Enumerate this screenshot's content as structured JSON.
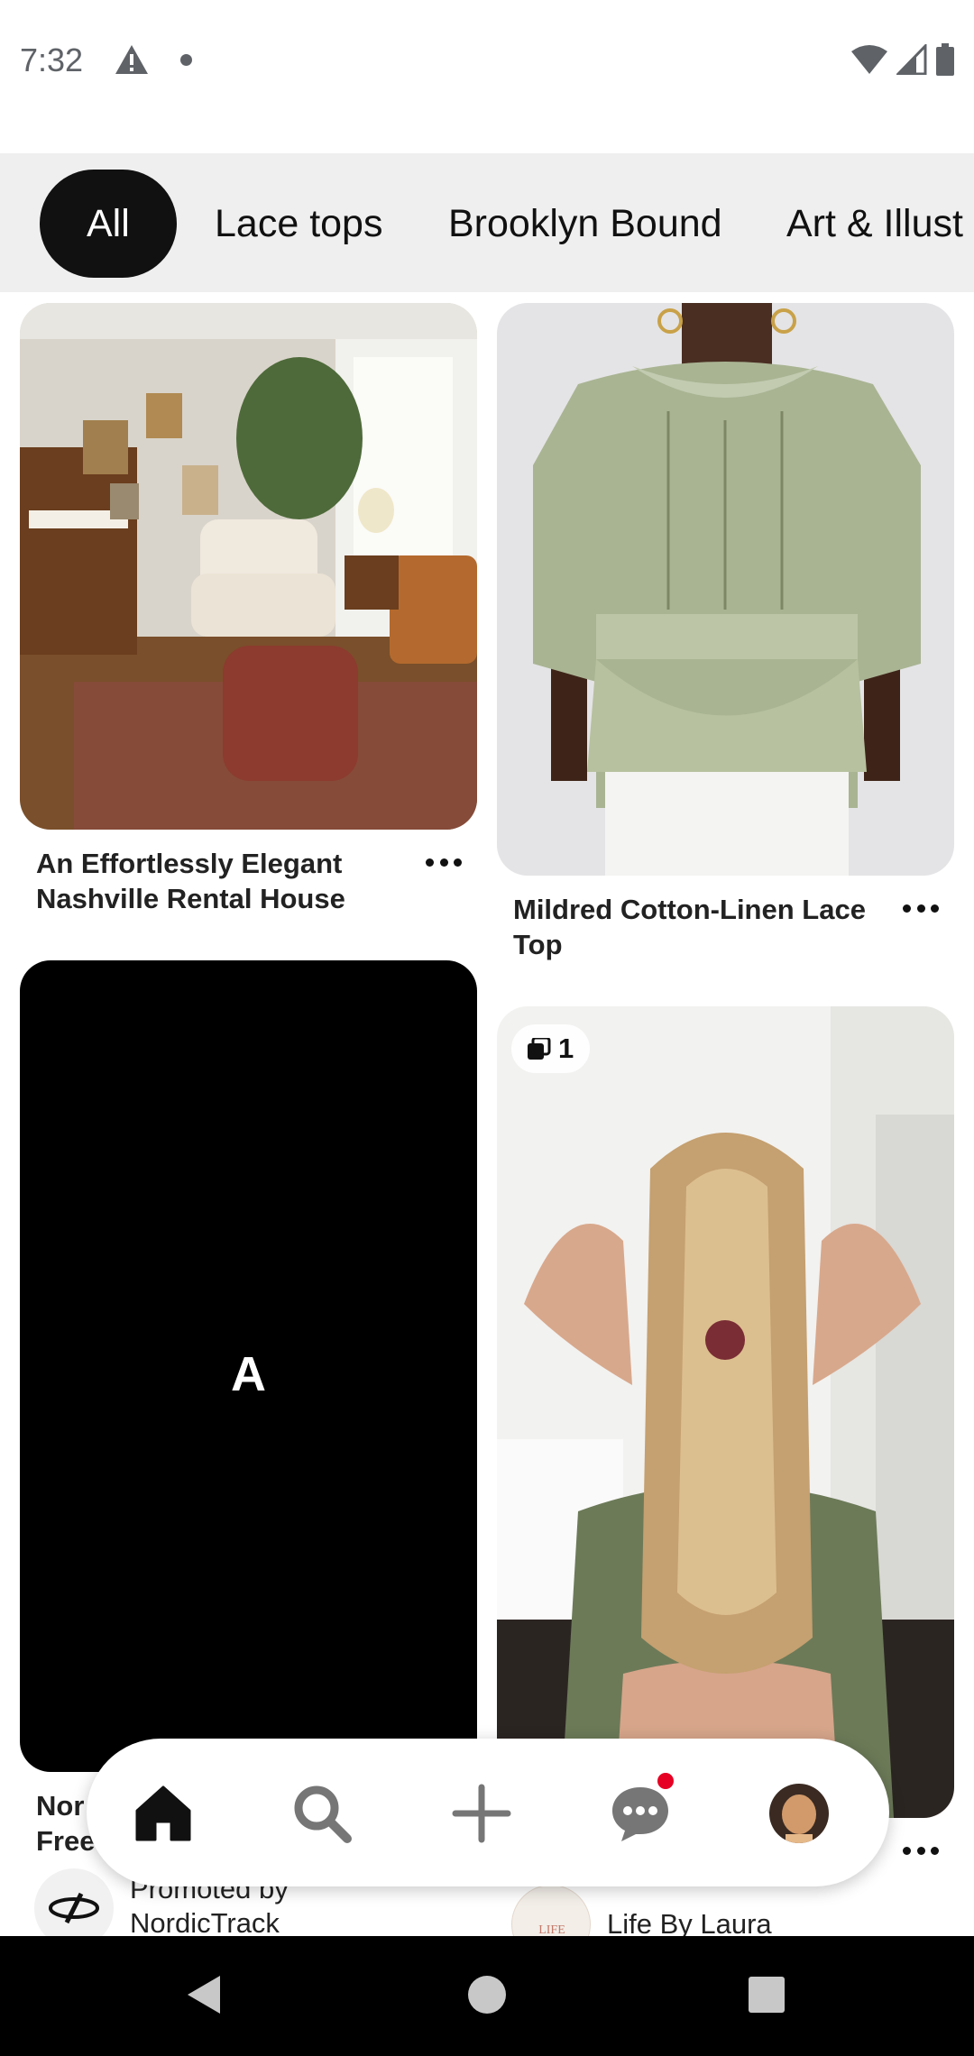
{
  "status_bar": {
    "time": "7:32"
  },
  "tabs": [
    {
      "label": "All",
      "active": true
    },
    {
      "label": "Lace tops",
      "active": false
    },
    {
      "label": "Brooklyn Bound",
      "active": false
    },
    {
      "label": "Art & Illust",
      "active": false
    }
  ],
  "pins": {
    "left_top": {
      "title_line1": "An Effortlessly Elegant",
      "title_line2": "Nashville Rental House"
    },
    "right_top": {
      "title_line1": "Mildred Cotton-Linen Lace",
      "title_line2": "Top"
    },
    "left_bottom": {
      "logo_letter": "A",
      "title_line1": "Nor",
      "title_line2": "Free",
      "promoted_line1": "Promoted by",
      "promoted_line2": "NordicTrack"
    },
    "right_bottom": {
      "badge_count": "1",
      "creator": "Life By Laura"
    }
  },
  "bottom_nav": {
    "items": [
      "home-icon",
      "search-icon",
      "create-icon",
      "messages-icon",
      "profile-avatar"
    ],
    "notification_color": "#e60023"
  }
}
